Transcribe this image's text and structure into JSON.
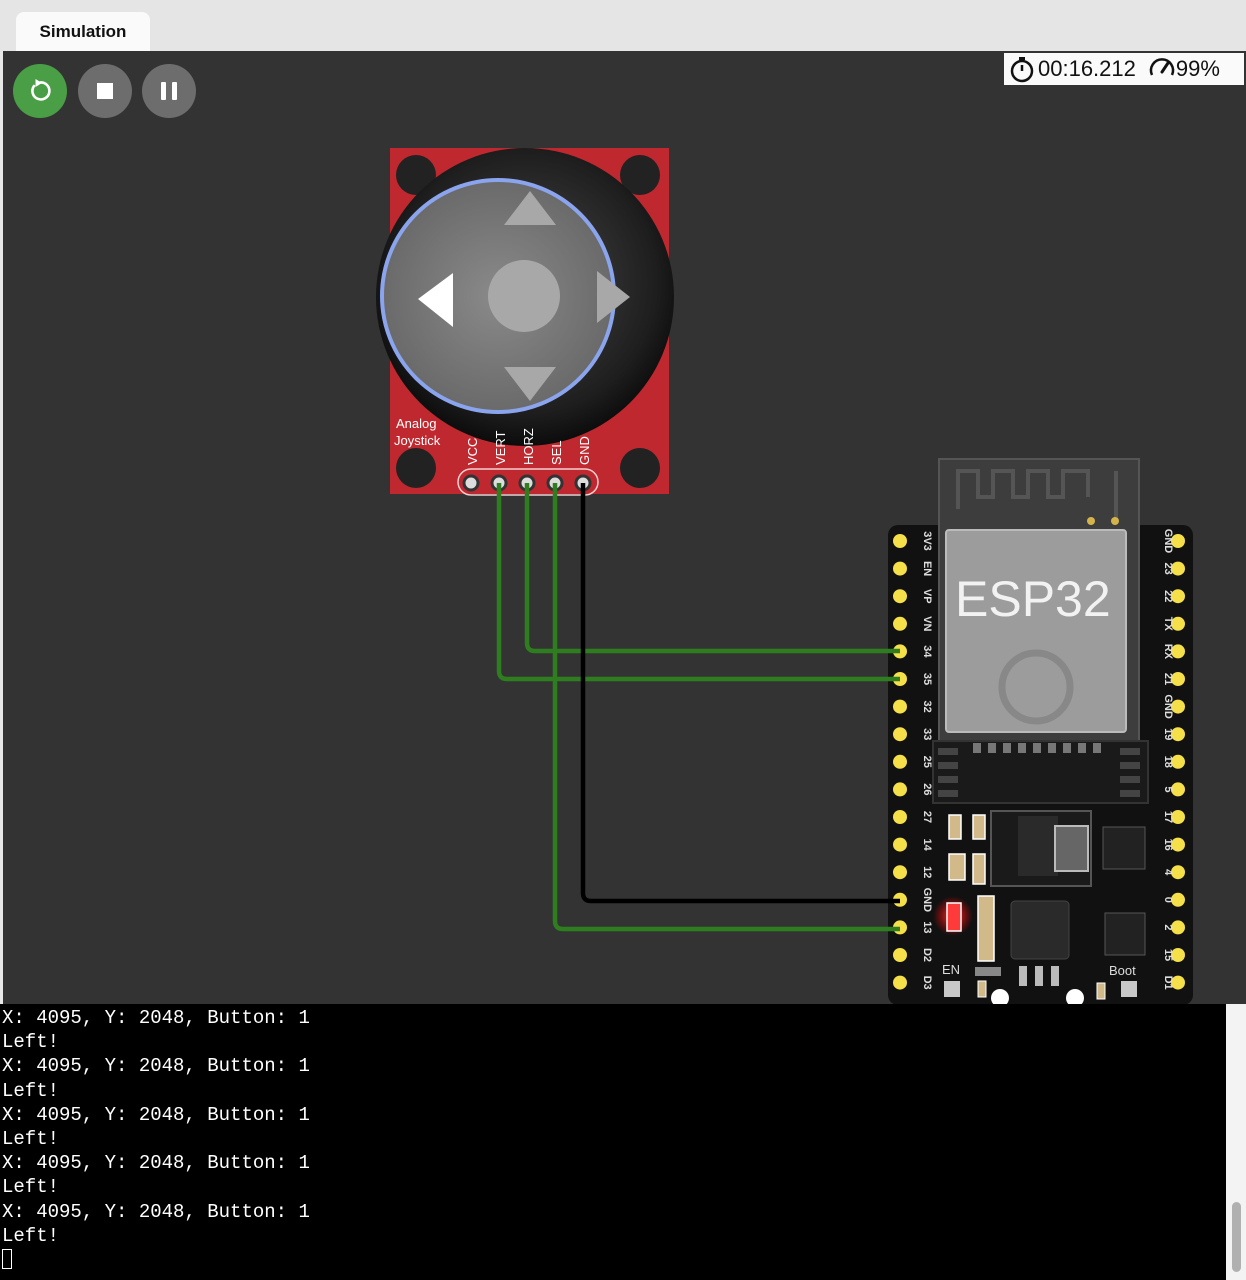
{
  "tab": {
    "label": "Simulation"
  },
  "controls": {
    "restart": "restart-icon",
    "stop": "stop-icon",
    "pause": "pause-icon"
  },
  "status": {
    "time": "00:16.212",
    "speed": "99%"
  },
  "joystick": {
    "label_line1": "Analog",
    "label_line2": "Joystick",
    "pins": [
      "VCC",
      "VERT",
      "HORZ",
      "SEL",
      "GND"
    ]
  },
  "esp32": {
    "title": "ESP32",
    "left_pins": [
      "3V3",
      "EN",
      "VP",
      "VN",
      "34",
      "35",
      "32",
      "33",
      "25",
      "26",
      "27",
      "14",
      "12",
      "GND",
      "13",
      "D2",
      "D3"
    ],
    "right_pins": [
      "GND",
      "23",
      "22",
      "TX",
      "RX",
      "21",
      "GND",
      "19",
      "18",
      "5",
      "17",
      "16",
      "4",
      "0",
      "2",
      "15",
      "D1"
    ],
    "en_label": "EN",
    "boot_label": "Boot"
  },
  "colors": {
    "wire_signal": "#2e7d1e",
    "wire_gnd": "#000000",
    "joystick_board": "#c0282f",
    "restart_bg": "#4a9e46"
  },
  "console": {
    "lines": [
      "X: 4095, Y: 2048, Button: 1",
      "Left!",
      "X: 4095, Y: 2048, Button: 1",
      "Left!",
      "X: 4095, Y: 2048, Button: 1",
      "Left!",
      "X: 4095, Y: 2048, Button: 1",
      "Left!",
      "X: 4095, Y: 2048, Button: 1",
      "Left!"
    ]
  }
}
